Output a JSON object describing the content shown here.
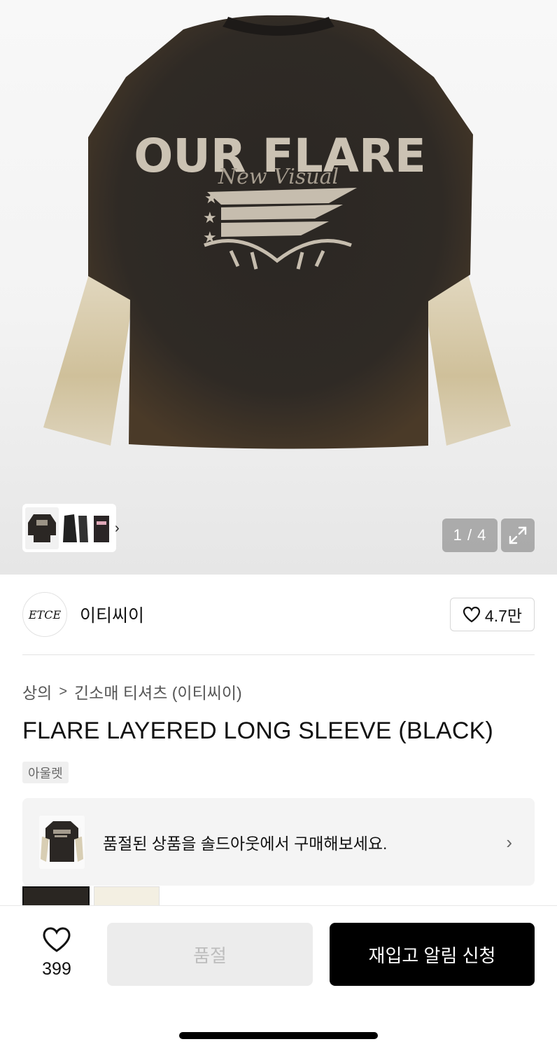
{
  "gallery": {
    "counter": "1 / 4",
    "product_print_text": "OUR FLARE",
    "product_script_text": "New Visual"
  },
  "brand": {
    "logo_text": "ETCE",
    "name": "이티씨이",
    "like_count": "4.7만"
  },
  "breadcrumb": {
    "items": [
      "상의",
      "긴소매 티셔츠 (이티씨이)"
    ],
    "separator": ">"
  },
  "product": {
    "title": "FLARE LAYERED LONG SLEEVE (BLACK)",
    "tag": "아울렛"
  },
  "soldout_banner": {
    "text": "품절된 상품을 솔드아웃에서 구매해보세요."
  },
  "bottom_bar": {
    "wish_count": "399",
    "soldout_label": "품절",
    "restock_label": "재입고 알림 신청"
  },
  "colors": {
    "primary_button": "#000000",
    "disabled_button": "#ececec",
    "garment_body": "#2a2521",
    "garment_sleeve": "#d8ceb4"
  }
}
